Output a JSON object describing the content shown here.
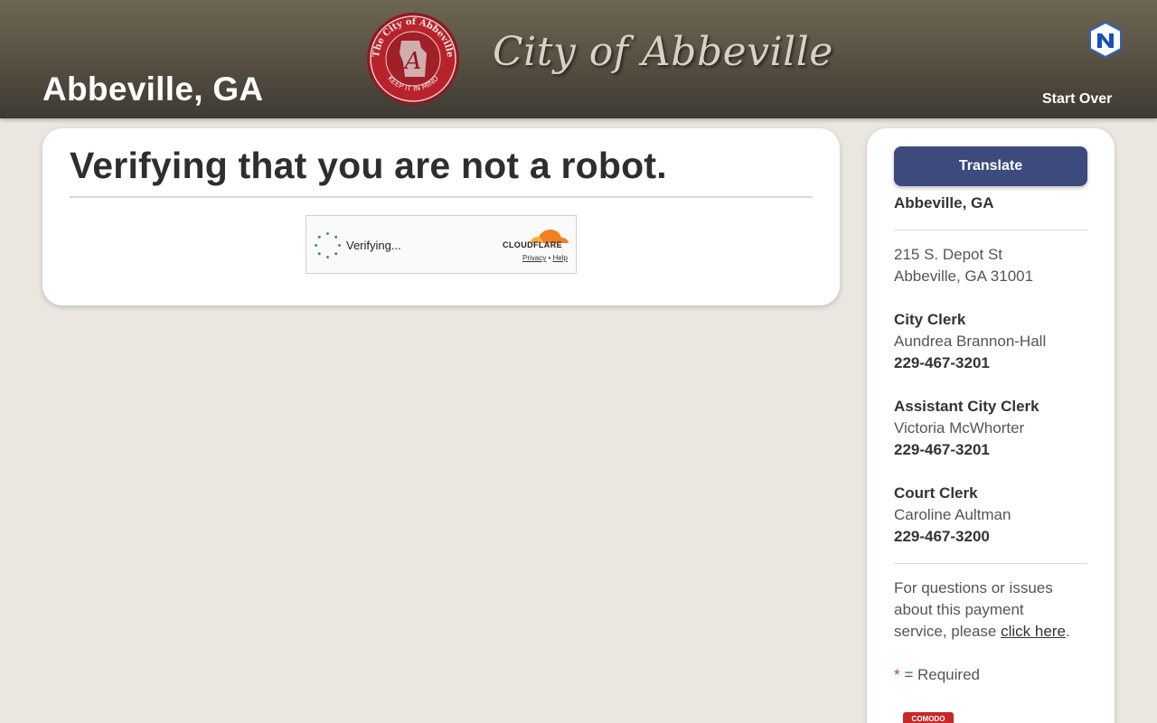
{
  "header": {
    "site_name": "Abbeville, GA",
    "seal_text_top": "The City of Abbeville",
    "seal_text_bottom": "KEEP IT IN MIND",
    "seal_letter": "A",
    "script_title": "City of Abbeville",
    "start_over_label": "Start Over",
    "brand_icon": "hexagon-logo-icon"
  },
  "main": {
    "heading": "Verifying that you are not a robot.",
    "captcha": {
      "status": "Verifying...",
      "brand": "CLOUDFLARE",
      "privacy_label": "Privacy",
      "separator": "•",
      "help_label": "Help"
    }
  },
  "sidebar": {
    "translate_label": "Translate",
    "org_name": "Abbeville, GA",
    "address_line1": "215 S. Depot St",
    "address_line2": "Abbeville, GA 31001",
    "contacts": [
      {
        "title": "City Clerk",
        "name": "Aundrea Brannon-Hall",
        "phone": "229-467-3201"
      },
      {
        "title": "Assistant City Clerk",
        "name": "Victoria McWhorter",
        "phone": "229-467-3201"
      },
      {
        "title": "Court Clerk",
        "name": "Caroline Aultman",
        "phone": "229-467-3200"
      }
    ],
    "help_text_1": "For questions or issues",
    "help_text_2": "about this payment",
    "help_text_3": "service, please ",
    "help_link": "click here",
    "help_text_end": ".",
    "required_star": "*",
    "required_text": " = Required",
    "badge_text": "COMODO"
  },
  "colors": {
    "header_bg": "#5a5344",
    "page_bg": "#ebe6e0",
    "button_bg": "#3d4a7e",
    "seal_red": "#b8232b",
    "cloudflare_orange": "#f38020"
  }
}
